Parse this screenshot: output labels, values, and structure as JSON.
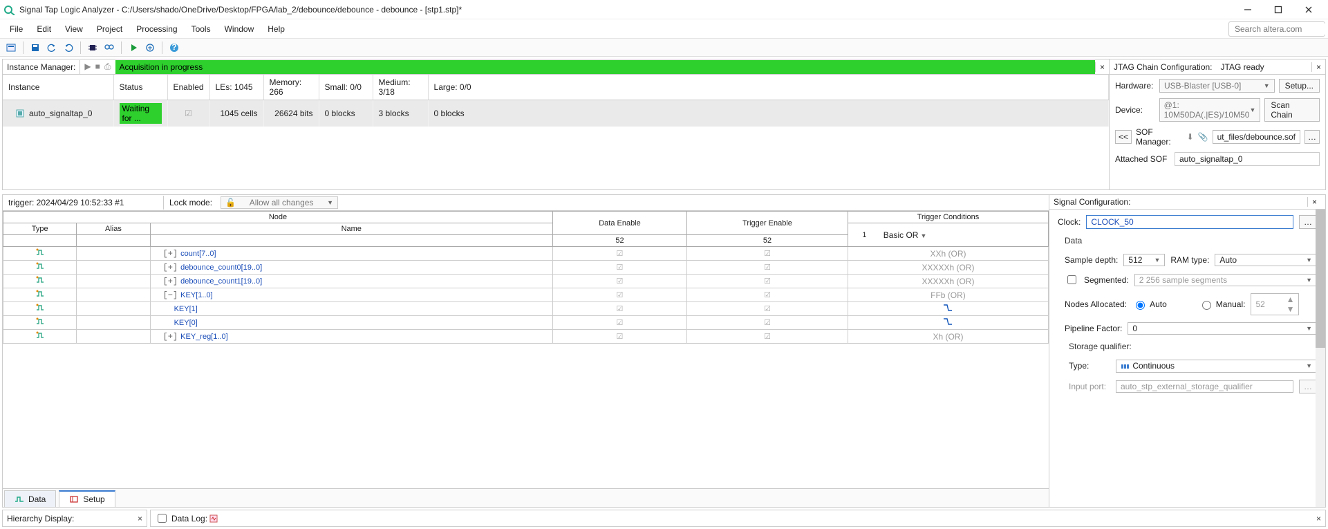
{
  "title": "Signal Tap Logic Analyzer - C:/Users/shado/OneDrive/Desktop/FPGA/lab_2/debounce/debounce - debounce - [stp1.stp]*",
  "menu": {
    "file": "File",
    "edit": "Edit",
    "view": "View",
    "project": "Project",
    "processing": "Processing",
    "tools": "Tools",
    "window": "Window",
    "help": "Help"
  },
  "search": {
    "placeholder": "Search altera.com"
  },
  "instance_mgr": {
    "label": "Instance Manager:",
    "status": "Acquisition in progress",
    "columns": {
      "instance": "Instance",
      "status": "Status",
      "enabled": "Enabled",
      "les": "LEs: 1045",
      "memory": "Memory: 266",
      "small": "Small: 0/0",
      "medium": "Medium: 3/18",
      "large": "Large: 0/0"
    },
    "row": {
      "name": "auto_signaltap_0",
      "status": "Waiting for ...",
      "cells": "1045 cells",
      "bits": "26624 bits",
      "small": "0 blocks",
      "medium": "3 blocks",
      "large": "0 blocks"
    }
  },
  "jtag": {
    "label": "JTAG Chain Configuration:",
    "ready": "JTAG ready",
    "hardware_label": "Hardware:",
    "hardware_value": "USB-Blaster [USB-0]",
    "setup": "Setup...",
    "device_label": "Device:",
    "device_value": "@1: 10M50DA(.|ES)/10M50",
    "scan": "Scan Chain",
    "back": "<<",
    "sof_label": "SOF Manager:",
    "sof_file": "ut_files/debounce.sof",
    "attached_label": "Attached SOF",
    "attached_value": "auto_signaltap_0"
  },
  "trigger": {
    "label": "trigger: 2024/04/29 10:52:33  #1",
    "lock_label": "Lock mode:",
    "lock_value": "Allow all changes"
  },
  "sigtable": {
    "node_hdr": "Node",
    "type_hdr": "Type",
    "alias_hdr": "Alias",
    "name_hdr": "Name",
    "de_hdr": "Data Enable",
    "te_hdr": "Trigger Enable",
    "tc_hdr": "Trigger Conditions",
    "de_val": "52",
    "te_val": "52",
    "tc_num": "1",
    "tc_mode": "Basic OR",
    "rows": [
      {
        "name": "count[7..0]",
        "cond": "XXh (OR)",
        "exp": "+"
      },
      {
        "name": "debounce_count0[19..0]",
        "cond": "XXXXXh (OR)",
        "exp": "+"
      },
      {
        "name": "debounce_count1[19..0]",
        "cond": "XXXXXh (OR)",
        "exp": "+"
      },
      {
        "name": "KEY[1..0]",
        "cond": "FFb (OR)",
        "exp": "-"
      },
      {
        "name": "KEY[1]",
        "cond": "edge",
        "child": true
      },
      {
        "name": "KEY[0]",
        "cond": "edge",
        "child": true
      },
      {
        "name": "KEY_reg[1..0]",
        "cond": "Xh (OR)",
        "exp": "+"
      }
    ],
    "tabs": {
      "data": "Data",
      "setup": "Setup"
    }
  },
  "config": {
    "header": "Signal Configuration:",
    "clock_label": "Clock:",
    "clock_value": "CLOCK_50",
    "data_label": "Data",
    "depth_label": "Sample depth:",
    "depth_value": "512",
    "ram_label": "RAM type:",
    "ram_value": "Auto",
    "seg_label": "Segmented:",
    "seg_value": "2  256 sample segments",
    "nodes_label": "Nodes Allocated:",
    "auto": "Auto",
    "manual": "Manual:",
    "manual_val": "52",
    "pipe_label": "Pipeline Factor:",
    "pipe_value": "0",
    "storage_label": "Storage qualifier:",
    "type_label": "Type:",
    "type_value": "Continuous",
    "port_label": "Input port:",
    "port_value": "auto_stp_external_storage_qualifier"
  },
  "bottom": {
    "hierarchy": "Hierarchy Display:",
    "datalog": "Data Log:"
  }
}
